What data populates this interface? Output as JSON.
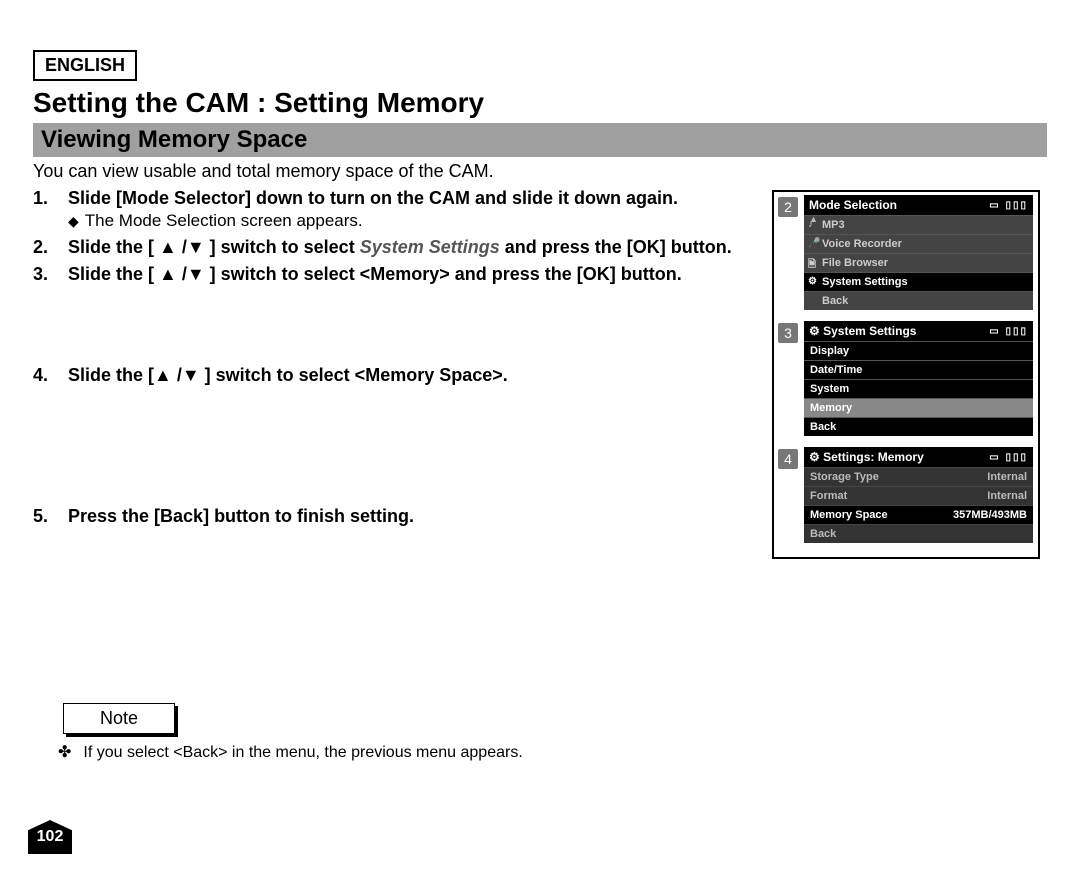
{
  "language": "ENGLISH",
  "title": "Setting the CAM : Setting Memory",
  "section": "Viewing Memory Space",
  "intro": "You can view usable and total memory space of the CAM.",
  "steps": {
    "s1": {
      "num": "1.",
      "body": "Slide [Mode Selector] down to turn on the CAM and slide it down again.",
      "sub": "The Mode Selection screen appears."
    },
    "s2": {
      "num": "2.",
      "pre": "Slide the [ ▲ /▼ ] switch to select ",
      "ital": "System Settings",
      "post": " and press the [OK] button."
    },
    "s3": {
      "num": "3.",
      "body": "Slide the [ ▲ /▼ ] switch to select <Memory> and press the [OK] button."
    },
    "s4": {
      "num": "4.",
      "body": "Slide the [▲ /▼ ] switch to select <Memory Space>."
    },
    "s5": {
      "num": "5.",
      "body": "Press the [Back] button to finish setting."
    }
  },
  "note": {
    "label": "Note",
    "text": "If you select <Back> in the menu, the previous menu appears."
  },
  "page_number": "102",
  "screens": {
    "scr2": {
      "badge": "2",
      "title": "Mode Selection",
      "items": [
        {
          "icon": "♪",
          "label": "MP3"
        },
        {
          "icon": "🎤",
          "label": "Voice Recorder"
        },
        {
          "icon": "🗎",
          "label": "File Browser"
        },
        {
          "icon": "⚙",
          "label": "System Settings",
          "selected": true
        },
        {
          "icon": "",
          "label": "Back"
        }
      ]
    },
    "scr3": {
      "badge": "3",
      "title": "System Settings",
      "items": [
        {
          "label": "Display",
          "style": "dark"
        },
        {
          "label": "Date/Time",
          "style": "dark"
        },
        {
          "label": "System",
          "style": "dark"
        },
        {
          "label": "Memory",
          "style": "sel"
        },
        {
          "label": "Back",
          "style": "dark"
        }
      ]
    },
    "scr4": {
      "badge": "4",
      "title": "Settings: Memory",
      "rows": [
        {
          "k": "Storage Type",
          "v": "Internal"
        },
        {
          "k": "Format",
          "v": "Internal"
        },
        {
          "k": "Memory Space",
          "v": "357MB/493MB",
          "selected": true
        },
        {
          "k": "Back",
          "v": ""
        }
      ]
    }
  }
}
